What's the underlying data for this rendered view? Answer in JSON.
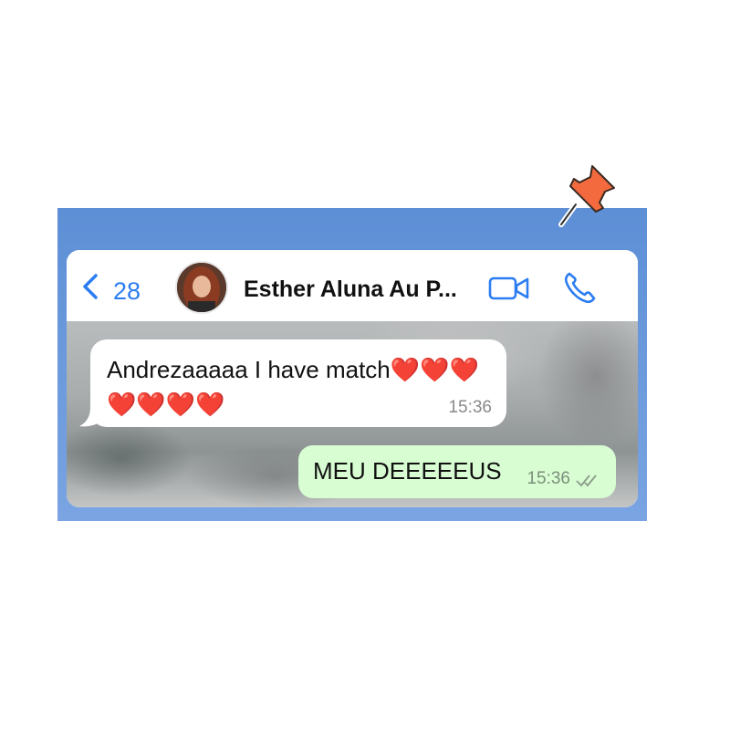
{
  "header": {
    "back_count": "28",
    "contact_name": "Esther Aluna Au P..."
  },
  "messages": [
    {
      "direction": "incoming",
      "text": "Andrezaaaaa I have match❤️❤️❤️❤️❤️❤️❤️",
      "time": "15:36"
    },
    {
      "direction": "outgoing",
      "text": "MEU DEEEEEUS",
      "time": "15:36",
      "status": "read"
    }
  ],
  "icons": {
    "back": "chevron-left-icon",
    "video": "video-camera-icon",
    "call": "phone-icon",
    "pin": "pushpin-icon",
    "read_receipt": "double-check-icon"
  },
  "colors": {
    "accent": "#2c7df2",
    "outgoing_bubble": "#d9fdd3",
    "frame": "#6a98dc",
    "pin": "#f26a3e"
  }
}
